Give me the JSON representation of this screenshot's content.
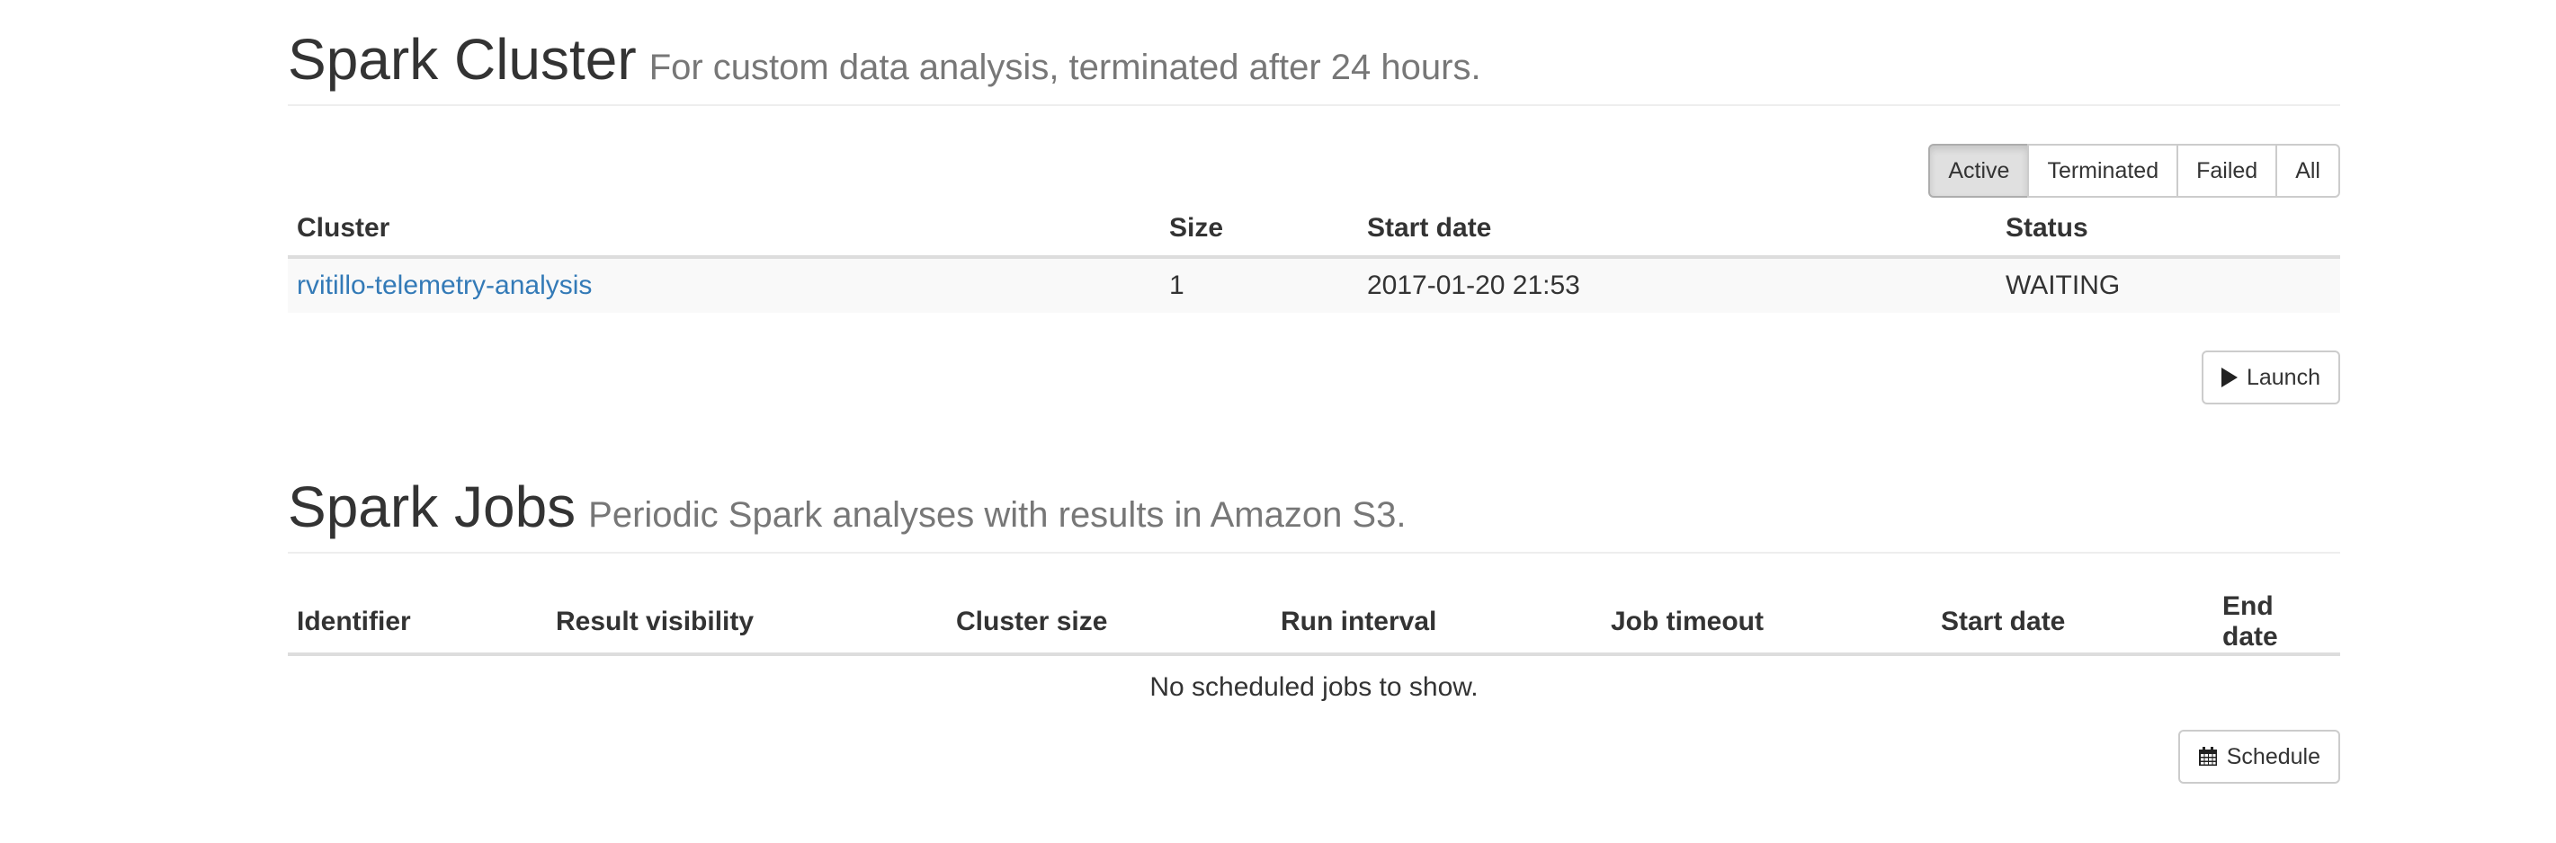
{
  "cluster_section": {
    "title": "Spark Cluster",
    "subtitle": "For custom data analysis, terminated after 24 hours.",
    "filters": [
      {
        "label": "Active",
        "active": true
      },
      {
        "label": "Terminated",
        "active": false
      },
      {
        "label": "Failed",
        "active": false
      },
      {
        "label": "All",
        "active": false
      }
    ],
    "columns": [
      "Cluster",
      "Size",
      "Start date",
      "Status"
    ],
    "rows": [
      {
        "cluster": "rvitillo-telemetry-analysis",
        "size": "1",
        "start_date": "2017-01-20 21:53",
        "status": "WAITING"
      }
    ],
    "launch_label": "Launch",
    "launch_icon": "play-icon"
  },
  "jobs_section": {
    "title": "Spark Jobs",
    "subtitle": "Periodic Spark analyses with results in Amazon S3.",
    "columns": [
      "Identifier",
      "Result visibility",
      "Cluster size",
      "Run interval",
      "Job timeout",
      "Start date",
      "End date"
    ],
    "empty_message": "No scheduled jobs to show.",
    "schedule_label": "Schedule",
    "schedule_icon": "calendar-icon"
  },
  "colors": {
    "link": "#337ab7",
    "muted": "#777777",
    "text": "#333333"
  }
}
